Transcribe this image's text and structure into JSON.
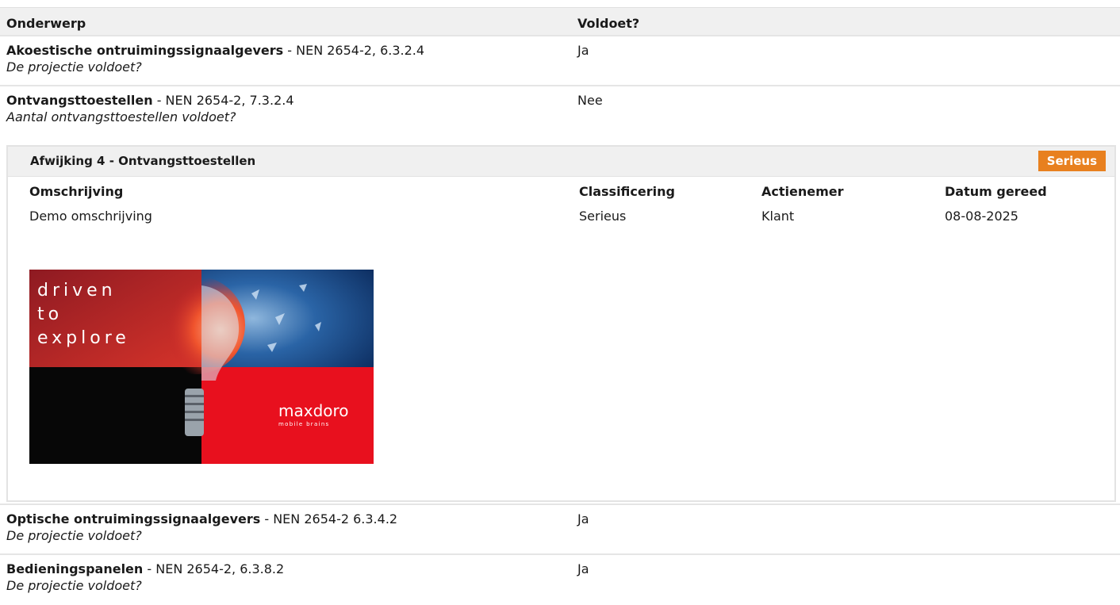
{
  "table": {
    "headers": {
      "subject": "Onderwerp",
      "compliant": "Voldoet?"
    },
    "rows": [
      {
        "subject": "Akoestische ontruimingssignaalgevers",
        "norm": " - NEN 2654-2, 6.3.2.4",
        "question": "De projectie voldoet?",
        "value": "Ja"
      },
      {
        "subject": "Ontvangsttoestellen",
        "norm": " - NEN 2654-2, 7.3.2.4",
        "question": "Aantal ontvangsttoestellen voldoet?",
        "value": "Nee"
      },
      {
        "subject": "Optische ontruimingssignaalgevers",
        "norm": " - NEN 2654-2 6.3.4.2",
        "question": "De projectie voldoet?",
        "value": "Ja"
      },
      {
        "subject": "Bedieningspanelen",
        "norm": " - NEN 2654-2, 6.3.8.2",
        "question": "De projectie voldoet?",
        "value": "Ja"
      }
    ]
  },
  "deviation": {
    "title": "Afwijking 4 - Ontvangsttoestellen",
    "badge": "Serieus",
    "badge_color": "#e8801f",
    "labels": {
      "description": "Omschrijving",
      "classification": "Classificering",
      "actor": "Actienemer",
      "due": "Datum gereed"
    },
    "values": {
      "description": "Demo omschrijving",
      "classification": "Serieus",
      "actor": "Klant",
      "due": "08-08-2025"
    },
    "image": {
      "text_line1": "driven",
      "text_line2": "to",
      "text_line3": "explore",
      "brand": "maxdoro",
      "tagline": "mobile brains",
      "brand_red": "#e8101e"
    }
  }
}
